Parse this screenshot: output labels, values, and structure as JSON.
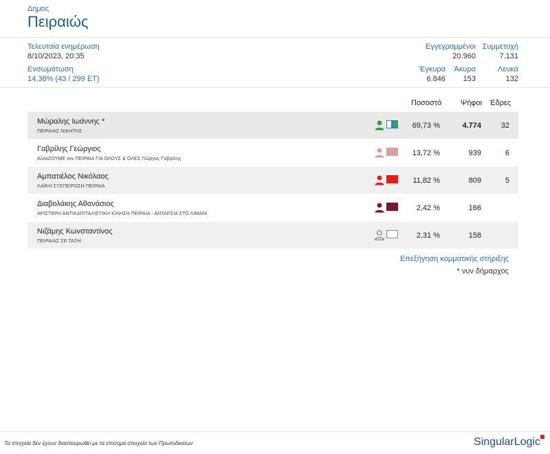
{
  "header": {
    "label": "Δημος",
    "title": "Πειραιώς"
  },
  "stats": {
    "last_update_label": "Τελευταία ενημέρωση",
    "last_update_value": "8/10/2023, 20:35",
    "integration_label": "Ενσωμάτωση",
    "integration_value": "14,38% (43 / 299 ΕΤ)",
    "registered_label": "Εγγεγραμμένοι",
    "registered_value": "20.960",
    "turnout_label": "Συμμετοχή",
    "turnout_value": "7.131",
    "valid_label": "Έγκυρα",
    "valid_value": "6.846",
    "invalid_label": "Άκυρα",
    "invalid_value": "153",
    "blank_label": "Λευκά",
    "blank_value": "132"
  },
  "results": {
    "columns": {
      "percent": "Ποσοστό",
      "votes": "Ψήφοι",
      "seats": "Έδρες"
    },
    "rows": [
      {
        "name": "Μώραλης Ιωάννης *",
        "party": "ΠΕΙΡΑΙΑΣ ΝΙΚΗΤΗΣ",
        "percent": "69,73 %",
        "votes": "4.774",
        "seats": "32",
        "person_color": "#2e9e3f",
        "swatch": "split-blue-green"
      },
      {
        "name": "Γαβρίλης Γεώργιος",
        "party": "ΑλλαΖΟΥΜΕ τον ΠΕΙΡΑΙΑ ΓΙΑ ΟΛΟΥΣ & ΟΛΕΣ Γιώργος Γαβρίλης",
        "percent": "13,72 %",
        "votes": "939",
        "seats": "6",
        "person_color": "#d9a2a2",
        "swatch": "#d7a0a0"
      },
      {
        "name": "Αμπατιέλος Νικόλαος",
        "party": "ΛΑΪΚΗ ΣΥΣΠΕΙΡΩΣΗ ΠΕΙΡΑΙΑ",
        "percent": "11,82 %",
        "votes": "809",
        "seats": "5",
        "person_color": "#e21d1d",
        "swatch": "#e21d1d"
      },
      {
        "name": "Διαβολάκης Αθανάσιος",
        "party": "ΑΡΙΣΤΕΡΗ ΑΝΤΙΚΑΠΙΤΑΛΙΣΤΙΚΗ ΚΙΝΗΣΗ ΠΕΙΡΑΙΑ - ΑΝΤΑΡΣΙΑ ΣΤΟ ΛΙΜΑΝΙ",
        "percent": "2,42 %",
        "votes": "166",
        "seats": "",
        "person_color": "#7a1730",
        "swatch": "#7a1730"
      },
      {
        "name": "Νιζάμης Κωνσταντίνος",
        "party": "ΠΕΙΡΑΙΑΣ ΣΕ ΤΑΞΗ",
        "percent": "2,31 %",
        "votes": "158",
        "seats": "",
        "person_color": "outline",
        "swatch": "#ffffff"
      }
    ]
  },
  "links": {
    "explain": "Επεξήγηση κομματικής στήριξης",
    "footnote": "* νυν δήμαρχος"
  },
  "footer": {
    "disclaimer": "Τα στοιχεία δεν έχουν διασταυρωθεί με τα επίσημα στοιχεία των Πρωτοδικείων",
    "logo": "SingularLogic"
  }
}
